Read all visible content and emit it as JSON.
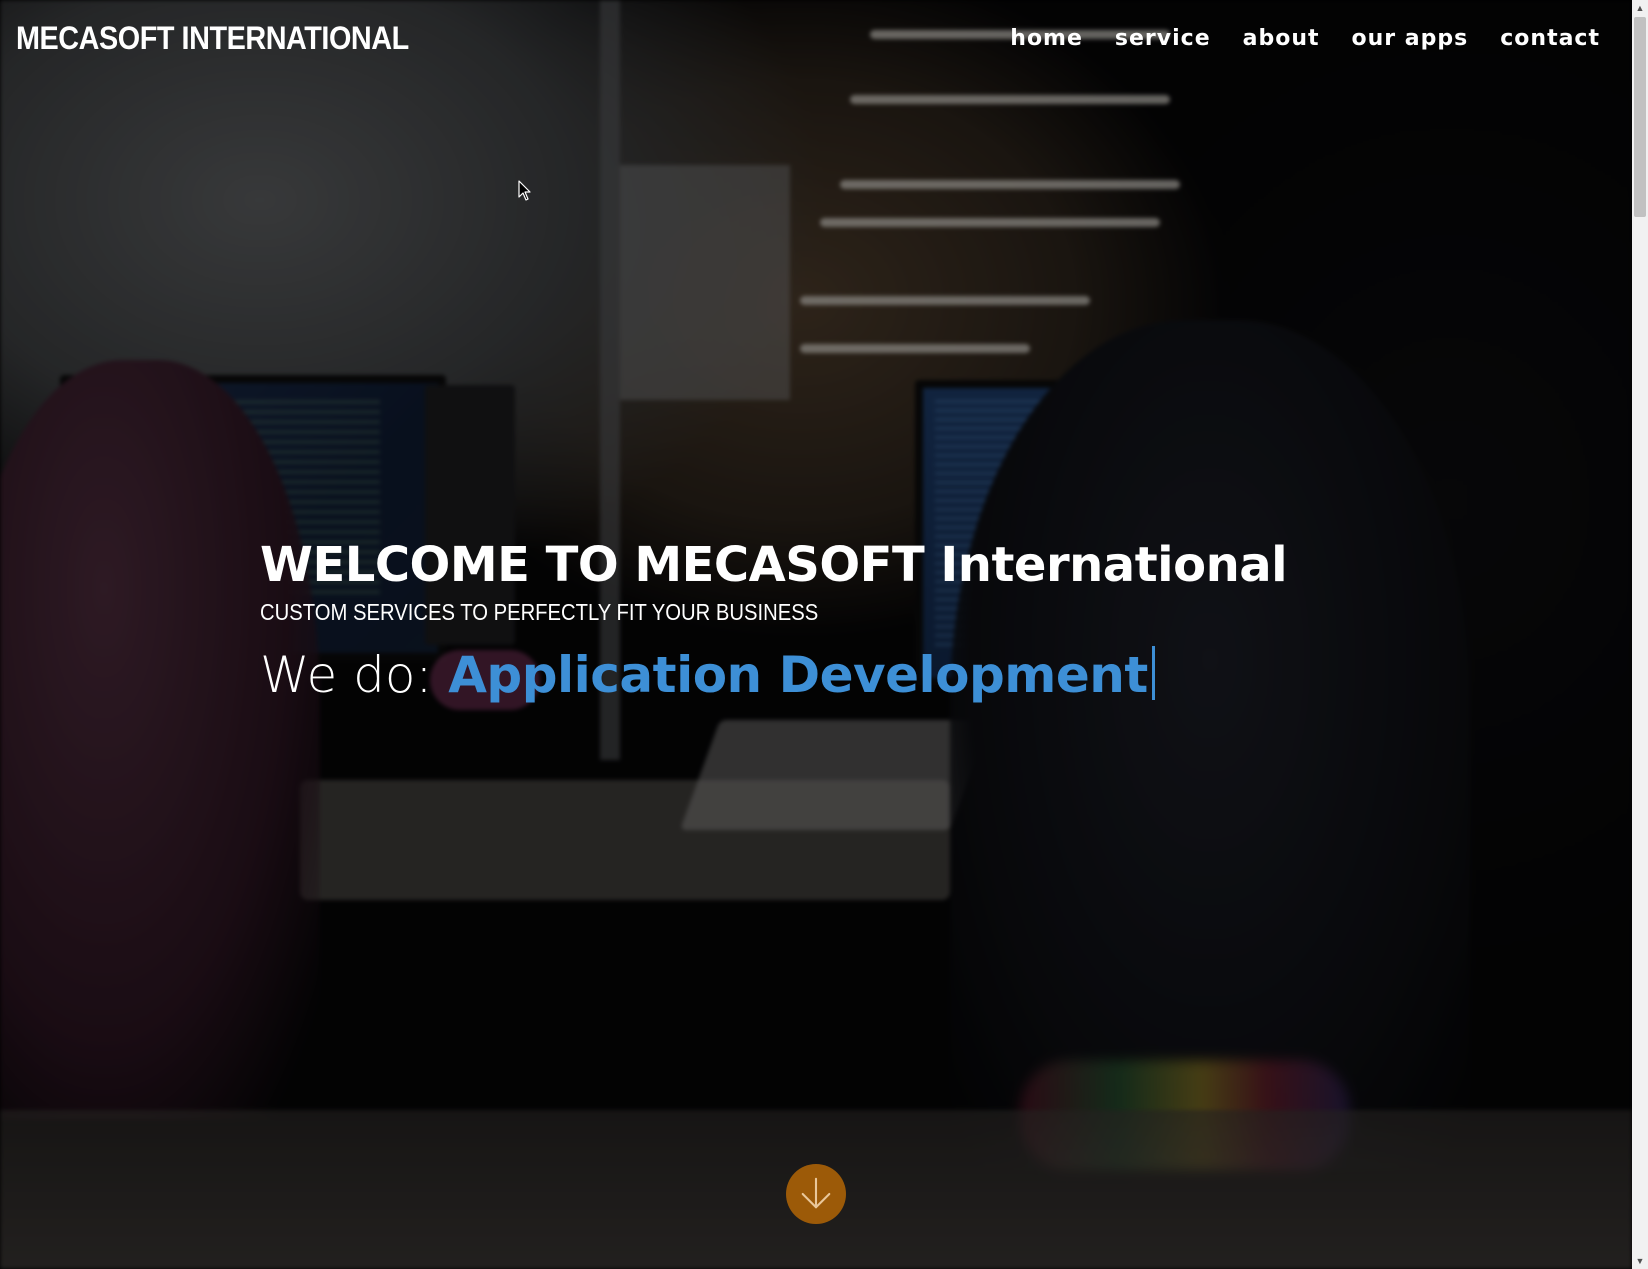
{
  "brand": {
    "title": "MECASOFT INTERNATIONAL"
  },
  "nav": {
    "items": [
      {
        "label": "home"
      },
      {
        "label": "service"
      },
      {
        "label": "about"
      },
      {
        "label": "our apps"
      },
      {
        "label": "contact"
      }
    ]
  },
  "hero": {
    "title": "WELCOME TO MECASOFT International",
    "subtitle": "CUSTOM SERVICES TO PERFECTLY FIT YOUR BUSINESS",
    "typed_prefix": "We do: ",
    "typed_word": "Application Development"
  },
  "scroll_button": {
    "icon": "arrow-down-icon"
  },
  "colors": {
    "accent_blue": "#3d8fd6",
    "scroll_button": "#9c5a08",
    "text": "#ffffff"
  }
}
